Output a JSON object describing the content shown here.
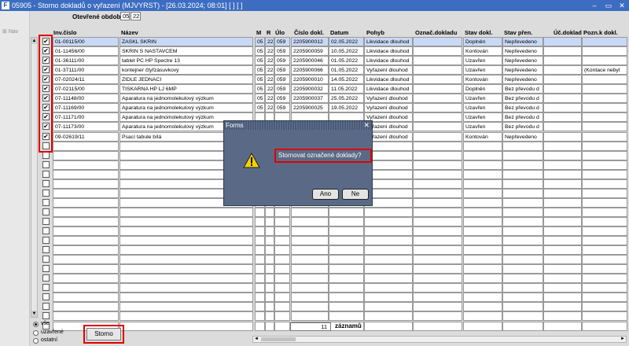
{
  "window": {
    "title": "05905 - Storno dokladů o vyřazení (MJVYRST) - [26.03.2024; 08:01] [ ] [ ]",
    "icon_label": "F",
    "controls": [
      "–",
      "▭",
      "✕"
    ]
  },
  "left_panel": {
    "nav_label": "Nav"
  },
  "period": {
    "label": "Otevřené období",
    "month": "05",
    "year": "22"
  },
  "columns": [
    "Inv.číslo",
    "Název",
    "M",
    "R",
    "Úlo",
    "Číslo dokl.",
    "Datum",
    "Pohyb",
    "Označ.dokladu",
    "Stav dokl.",
    "Stav přen.",
    "Úč.doklad",
    "Pozn.k dokl."
  ],
  "rows": [
    {
      "checked": true,
      "inv": "01-00115/00",
      "nazev": "ZASKL SKRIN",
      "m": "05",
      "r": "22",
      "ulo": "059",
      "cislo": "2205900012",
      "datum": "02.05.2022",
      "pohyb": "Likvidace dlouhod",
      "oznac": "",
      "stav": "Doplněn",
      "stavpren": "Nepřevedeno",
      "ucdoklad": "",
      "pozn": ""
    },
    {
      "checked": true,
      "inv": "01-11456/00",
      "nazev": "SKRIN S NASTAVCEM",
      "m": "05",
      "r": "22",
      "ulo": "059",
      "cislo": "2205900059",
      "datum": "10.05.2022",
      "pohyb": "Likvidace dlouhod",
      "oznac": "",
      "stav": "Kontován",
      "stavpren": "Nepřevedeno",
      "ucdoklad": "",
      "pozn": ""
    },
    {
      "checked": true,
      "inv": "01-36111/00",
      "nazev": "tablet PC HP Spectre 13",
      "m": "05",
      "r": "22",
      "ulo": "059",
      "cislo": "2205900046",
      "datum": "01.05.2022",
      "pohyb": "Likvidace dlouhod",
      "oznac": "",
      "stav": "Uzavřen",
      "stavpren": "Nepřevedeno",
      "ucdoklad": "",
      "pozn": ""
    },
    {
      "checked": true,
      "inv": "01-37111/00",
      "nazev": "kontejner čtyřzásuvkový",
      "m": "05",
      "r": "22",
      "ulo": "059",
      "cislo": "2205900066",
      "datum": "01.05.2022",
      "pohyb": "Vyřazení dlouhod",
      "oznac": "",
      "stav": "Uzavřen",
      "stavpren": "Nepřevedeno",
      "ucdoklad": "",
      "pozn": "(Kontace nebyl"
    },
    {
      "checked": true,
      "inv": "07-02024/11",
      "nazev": "ZIDLE JEDNACI",
      "m": "05",
      "r": "22",
      "ulo": "059",
      "cislo": "2205900010",
      "datum": "14.05.2022",
      "pohyb": "Likvidace dlouhod",
      "oznac": "",
      "stav": "Kontován",
      "stavpren": "Nepřevedeno",
      "ucdoklad": "",
      "pozn": ""
    },
    {
      "checked": true,
      "inv": "07-02115/00",
      "nazev": "TISKARNA HP LJ 6MP",
      "m": "05",
      "r": "22",
      "ulo": "059",
      "cislo": "2205900032",
      "datum": "11.05.2022",
      "pohyb": "Likvidace dlouhod",
      "oznac": "",
      "stav": "Doplněn",
      "stavpren": "Bez převodu d",
      "ucdoklad": "",
      "pozn": ""
    },
    {
      "checked": true,
      "inv": "07-11148/00",
      "nazev": "Aparatura na jednomolekulový výzkum",
      "m": "05",
      "r": "22",
      "ulo": "059",
      "cislo": "2205900037",
      "datum": "25.05.2022",
      "pohyb": "Vyřazení dlouhod",
      "oznac": "",
      "stav": "Uzavřen",
      "stavpren": "Bez převodu d",
      "ucdoklad": "",
      "pozn": ""
    },
    {
      "checked": true,
      "inv": "07-11169/00",
      "nazev": "Aparatura na jednomolekulový výzkum",
      "m": "05",
      "r": "22",
      "ulo": "059",
      "cislo": "2205900025",
      "datum": "19.05.2022",
      "pohyb": "Vyřazení dlouhod",
      "oznac": "",
      "stav": "Uzavřen",
      "stavpren": "Bez převodu d",
      "ucdoklad": "",
      "pozn": ""
    },
    {
      "checked": true,
      "inv": "07-11171/00",
      "nazev": "Aparatura na jednomolekulový výzkum",
      "m": "",
      "r": "",
      "ulo": "",
      "cislo": "",
      "datum": "",
      "pohyb": "Vyřazení dlouhod",
      "oznac": "",
      "stav": "Uzavřen",
      "stavpren": "Bez převodu d",
      "ucdoklad": "",
      "pozn": ""
    },
    {
      "checked": true,
      "inv": "07-11173/00",
      "nazev": "Aparatura na jednomolekulový výzkum",
      "m": "",
      "r": "",
      "ulo": "",
      "cislo": "",
      "datum": "",
      "pohyb": "Vyřazení dlouhod",
      "oznac": "",
      "stav": "Uzavřen",
      "stavpren": "Bez převodu d",
      "ucdoklad": "",
      "pozn": ""
    },
    {
      "checked": true,
      "inv": "09-02619/11",
      "nazev": "Psací tabule bílá",
      "m": "",
      "r": "",
      "ulo": "",
      "cislo": "",
      "datum": "",
      "pohyb": "Vyřazení dlouhod",
      "oznac": "",
      "stav": "Kontován",
      "stavpren": "Nepřevedeno",
      "ucdoklad": "",
      "pozn": ""
    }
  ],
  "empty_rows": 20,
  "dialog": {
    "title": "Forms",
    "close": "✕",
    "message": "Stornovat označené doklady?",
    "yes": "Ano",
    "no": "Ne"
  },
  "filter": {
    "options": [
      {
        "label": "vše",
        "selected": true
      },
      {
        "label": "uzavřené",
        "selected": false
      },
      {
        "label": "ostatní",
        "selected": false
      }
    ]
  },
  "storno_button": "Storno",
  "record_count": "11",
  "record_label": "záznamů",
  "colors": {
    "title_bar": "#3d6dc2",
    "highlight": "#e00000",
    "selected_row": "#c9d9f5",
    "dialog_bg": "#5a6a86"
  }
}
